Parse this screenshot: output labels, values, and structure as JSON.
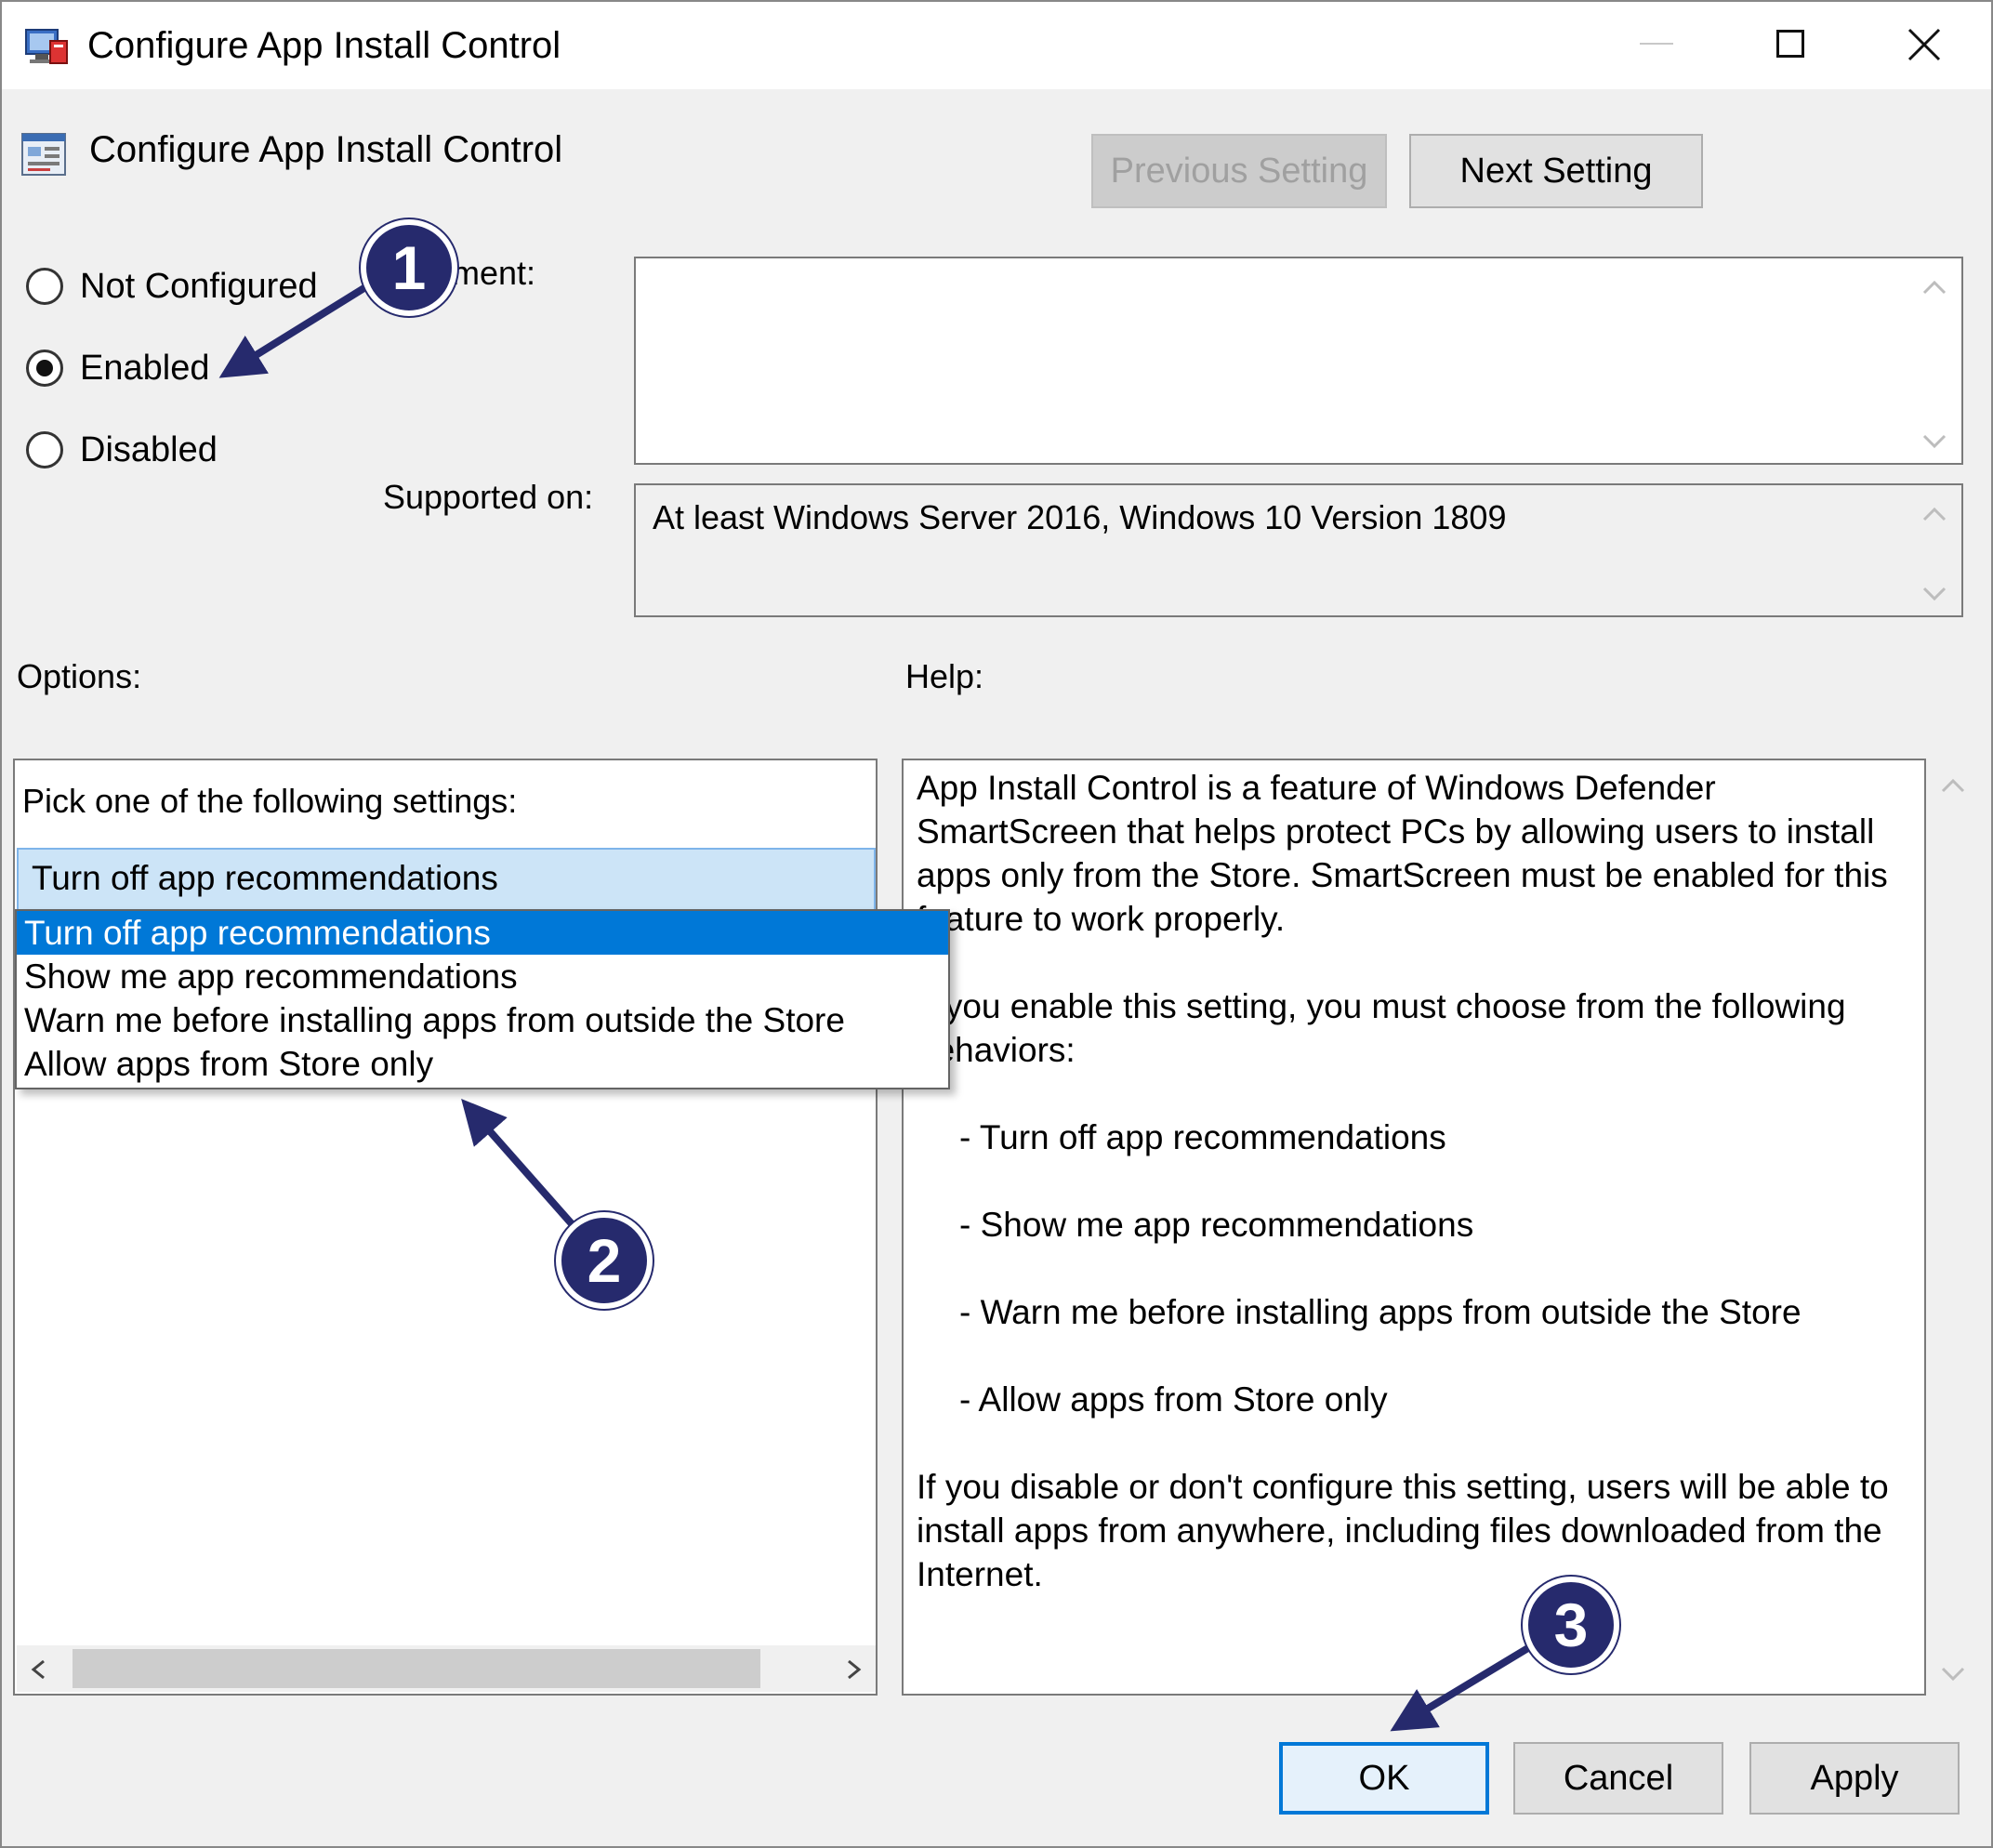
{
  "window": {
    "title": "Configure App Install Control"
  },
  "header": {
    "policy_name": "Configure App Install Control",
    "previous_label": "Previous Setting",
    "next_label": "Next Setting"
  },
  "state": {
    "options": [
      {
        "label": "Not Configured",
        "checked": false
      },
      {
        "label": "Enabled",
        "checked": true
      },
      {
        "label": "Disabled",
        "checked": false
      }
    ]
  },
  "comment": {
    "label": "ment:",
    "value": ""
  },
  "supported": {
    "label": "Supported on:",
    "value": "At least Windows Server 2016, Windows 10 Version 1809"
  },
  "options_panel": {
    "label": "Options:",
    "pick_label": "Pick one of the following settings:",
    "selected_value": "Turn off app recommendations",
    "dropdown_items": [
      "Turn off app recommendations",
      "Show me app recommendations",
      "Warn me before installing apps from outside the Store",
      "Allow apps from Store only"
    ]
  },
  "help_panel": {
    "label": "Help:",
    "lines": [
      "App Install Control is a feature of Windows Defender",
      "SmartScreen that helps protect PCs by allowing users to install",
      "apps only from the Store.  SmartScreen must be enabled for this",
      "feature to work properly.",
      "",
      "If you enable this setting, you must choose from the following",
      "behaviors:",
      "",
      "- Turn off app recommendations",
      "",
      "- Show me app recommendations",
      "",
      "- Warn me before installing apps from outside the Store",
      "",
      "- Allow apps from Store only",
      "",
      "If you disable or don't configure this setting, users will be able to",
      "install apps from anywhere, including files downloaded from the",
      "Internet."
    ]
  },
  "footer": {
    "ok_label": "OK",
    "cancel_label": "Cancel",
    "apply_label": "Apply"
  },
  "callouts": {
    "one": "1",
    "two": "2",
    "three": "3",
    "color": "#262a6d"
  },
  "colors": {
    "accent": "#0078d7",
    "combo_highlight": "#cce4f7"
  }
}
